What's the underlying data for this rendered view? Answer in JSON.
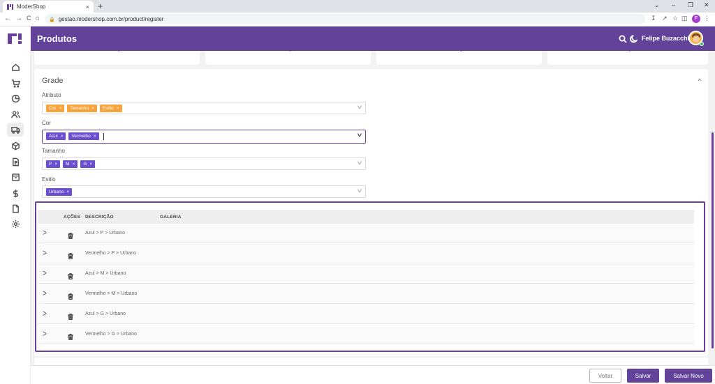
{
  "browser": {
    "tab_title": "ModerShop",
    "tab_close": "×",
    "new_tab": "+",
    "url": "gestao.modershop.com.br/product/register",
    "profile_initial": "F",
    "window_controls": [
      "⌄",
      "–",
      "❐",
      "✕"
    ],
    "nav": {
      "back": "←",
      "forward": "→",
      "reload": "C",
      "home": "⌂"
    }
  },
  "header": {
    "title": "Produtos",
    "user_name": "Felipe Buzacchi",
    "brand_color": "#63439a"
  },
  "sidebar": {
    "items": [
      {
        "icon": "home-icon"
      },
      {
        "icon": "cart-icon"
      },
      {
        "icon": "pie-chart-icon"
      },
      {
        "icon": "users-icon"
      },
      {
        "icon": "truck-icon",
        "active": true
      },
      {
        "icon": "box-icon"
      },
      {
        "icon": "document-icon"
      },
      {
        "icon": "archive-icon"
      },
      {
        "icon": "dollar-icon"
      },
      {
        "icon": "file-icon"
      },
      {
        "icon": "gear-icon"
      }
    ]
  },
  "grade": {
    "title": "Grade",
    "toggle": "^",
    "fields": [
      {
        "label": "Atributo",
        "chips": [
          "Cor",
          "Tamanho",
          "Estilo"
        ],
        "chip_color": "orange"
      },
      {
        "label": "Cor",
        "chips": [
          "Azul",
          "Vermelho"
        ],
        "chip_color": "purple",
        "focused": true
      },
      {
        "label": "Tamanho",
        "chips": [
          "P",
          "M",
          "G"
        ],
        "chip_color": "purple"
      },
      {
        "label": "Estilo",
        "chips": [
          "Urbano"
        ],
        "chip_color": "purple"
      }
    ],
    "chip_remove": "×",
    "chevron": "v"
  },
  "table": {
    "headers": {
      "acoes": "AÇÕES",
      "descricao": "DESCRIÇÃO",
      "galeria": "GALERIA"
    },
    "expand_glyph": ">",
    "rows": [
      {
        "description": "Azul > P > Urbano"
      },
      {
        "description": "Vermelho > P > Urbano"
      },
      {
        "description": "Azul > M > Urbano"
      },
      {
        "description": "Vermelho > M > Urbano"
      },
      {
        "description": "Azul > G > Urbano"
      },
      {
        "description": "Vermelho > G > Urbano"
      }
    ]
  },
  "footer": {
    "voltar": "Voltar",
    "salvar": "Salvar",
    "salvar_novo": "Salvar Novo"
  }
}
